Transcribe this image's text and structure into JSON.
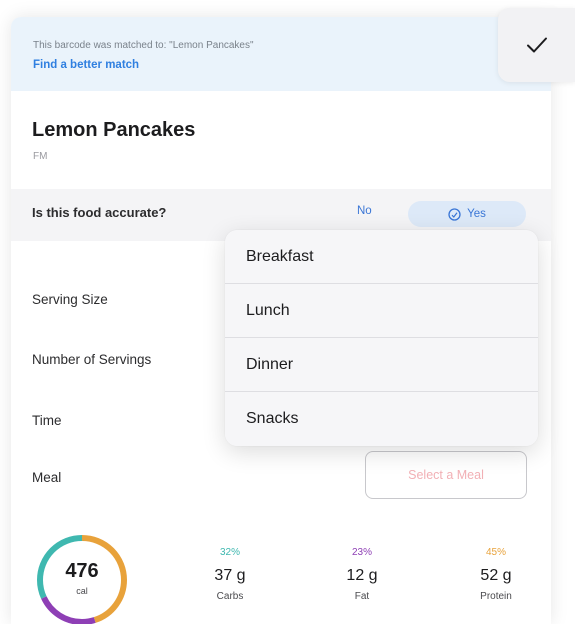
{
  "banner": {
    "match_text": "This barcode was matched to: \"Lemon  Pancakes\"",
    "better_match_link": "Find a better match"
  },
  "done_button": {
    "icon": "checkmark-icon"
  },
  "food": {
    "name": "Lemon  Pancakes",
    "brand": "FM"
  },
  "accuracy": {
    "question": "Is this food accurate?",
    "no_label": "No",
    "yes_label": "Yes"
  },
  "fields": {
    "serving_size": "Serving Size",
    "number_of_servings": "Number of Servings",
    "time": "Time",
    "meal": "Meal",
    "meal_placeholder": "Select a Meal"
  },
  "meal_menu": {
    "items": [
      "Breakfast",
      "Lunch",
      "Dinner",
      "Snacks"
    ]
  },
  "calories": {
    "value": "476",
    "unit": "cal"
  },
  "macros": [
    {
      "pct": "32%",
      "amount": "37 g",
      "name": "Carbs",
      "color": "#3fb8b0"
    },
    {
      "pct": "23%",
      "amount": "12 g",
      "name": "Fat",
      "color": "#8e3fb5"
    },
    {
      "pct": "45%",
      "amount": "52 g",
      "name": "Protein",
      "color": "#e8a23b"
    }
  ]
}
